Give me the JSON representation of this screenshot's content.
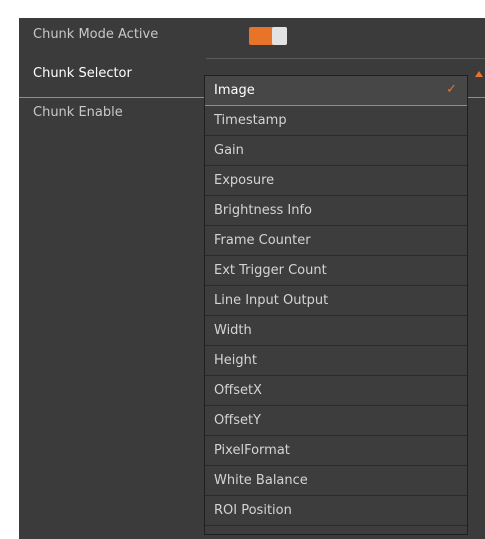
{
  "properties": [
    {
      "label": "Chunk Mode Active"
    },
    {
      "label": "Chunk Selector"
    },
    {
      "label": "Chunk Enable"
    }
  ],
  "chunk_mode_active": {
    "enabled": true
  },
  "chunk_selector": {
    "selected": "Image",
    "options": [
      "Image",
      "Timestamp",
      "Gain",
      "Exposure",
      "Brightness Info",
      "Frame Counter",
      "Ext Trigger Count",
      "Line Input Output",
      "Width",
      "Height",
      "OffsetX",
      "OffsetY",
      "PixelFormat",
      "White Balance",
      "ROI Position"
    ]
  },
  "icons": {
    "selected_check": "✓",
    "dropdown_arrow": "triangle-up-icon"
  },
  "colors": {
    "accent": "#e8742a",
    "panel_background": "#3b3b3b"
  }
}
